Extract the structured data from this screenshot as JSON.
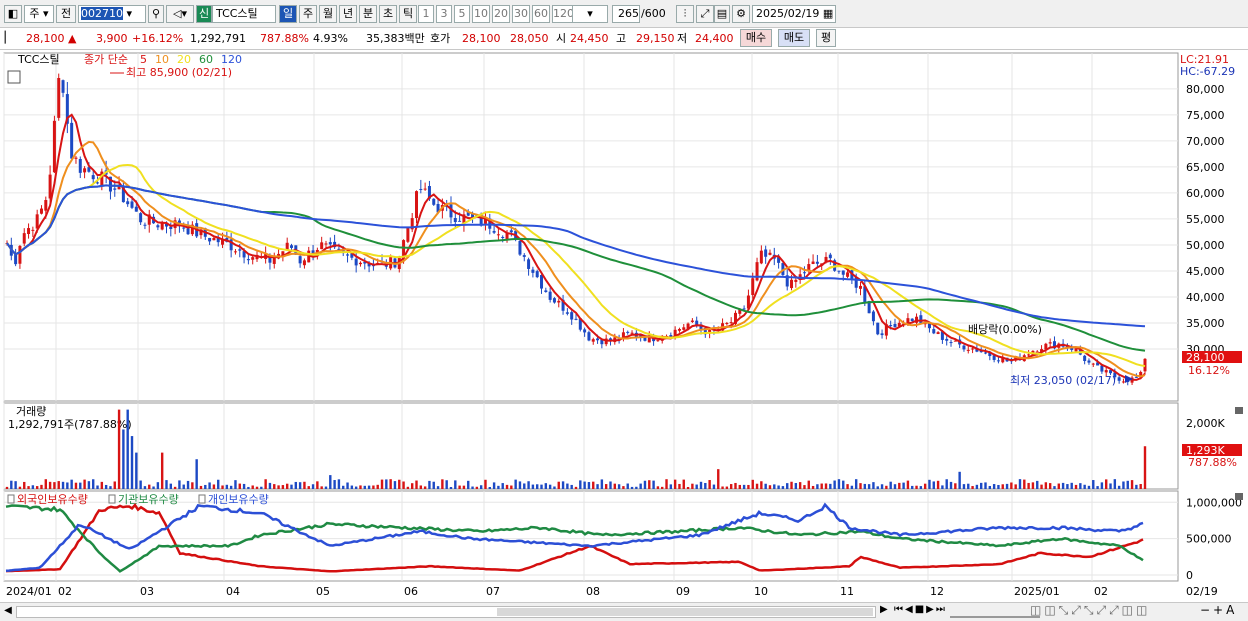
{
  "toolbar": {
    "period_type": "주",
    "prev": "전",
    "code": "002710",
    "badge": "신",
    "name": "TCC스틸",
    "tabs": [
      "일",
      "주",
      "월",
      "년",
      "분",
      "초",
      "틱"
    ],
    "active_tab": "일",
    "intervals": [
      "1",
      "3",
      "5",
      "10",
      "20",
      "30",
      "60",
      "120"
    ],
    "count": "265",
    "max_count": "/600",
    "date": "2025/02/19"
  },
  "info": {
    "price": "28,100",
    "change": "3,900",
    "change_pct": "+16.12%",
    "volume": "1,292,791",
    "volume_ratio": "787.88%",
    "turnover": "4.93%",
    "amount": "35,383백만",
    "quote_label": "호가",
    "ask": "28,100",
    "bid": "28,050",
    "open_label": "시",
    "open": "24,450",
    "high_label": "고",
    "high": "29,150",
    "low_label": "저",
    "low": "24,400",
    "buy_btn": "매수",
    "sell_btn": "매도",
    "eval_btn": "평"
  },
  "price_panel": {
    "name_tag": "TCC스틸",
    "ma_label": "종가 단순",
    "ma_periods": [
      "5",
      "10",
      "20",
      "60",
      "120"
    ],
    "ma_colors": [
      "#d81414",
      "#ef8f1e",
      "#f0e020",
      "#1f8f3a",
      "#2c52d9"
    ],
    "lc": "LC:21.91",
    "hc": "HC:-67.29",
    "high_marker": "최고 85,900 (02/21)",
    "low_marker": "최저 23,050 (02/17)",
    "dividend": "배당락(0.00%)",
    "last_price": "28,100",
    "last_pct": "16.12%",
    "y_ticks": [
      "80,000",
      "75,000",
      "70,000",
      "65,000",
      "60,000",
      "55,000",
      "50,000",
      "45,000",
      "40,000",
      "35,000",
      "30,000"
    ]
  },
  "volume_panel": {
    "title": "거래량",
    "value": "1,292,791주(787.88%)",
    "tick": "2,000K",
    "last": "1,293K",
    "last_pct": "787.88%"
  },
  "holding_panel": {
    "series": [
      "외국인보유수량",
      "기관보유수량",
      "개인보유수량"
    ],
    "colors": [
      "#d40f0f",
      "#1f8a43",
      "#2c4fd6"
    ],
    "y_ticks": [
      "1,000,000",
      "500,000",
      "0"
    ]
  },
  "x_axis": {
    "labels": [
      "2024/01",
      "02",
      "03",
      "04",
      "05",
      "06",
      "07",
      "08",
      "09",
      "10",
      "11",
      "12",
      "2025/01",
      "02"
    ],
    "end_label": "02/19"
  }
}
